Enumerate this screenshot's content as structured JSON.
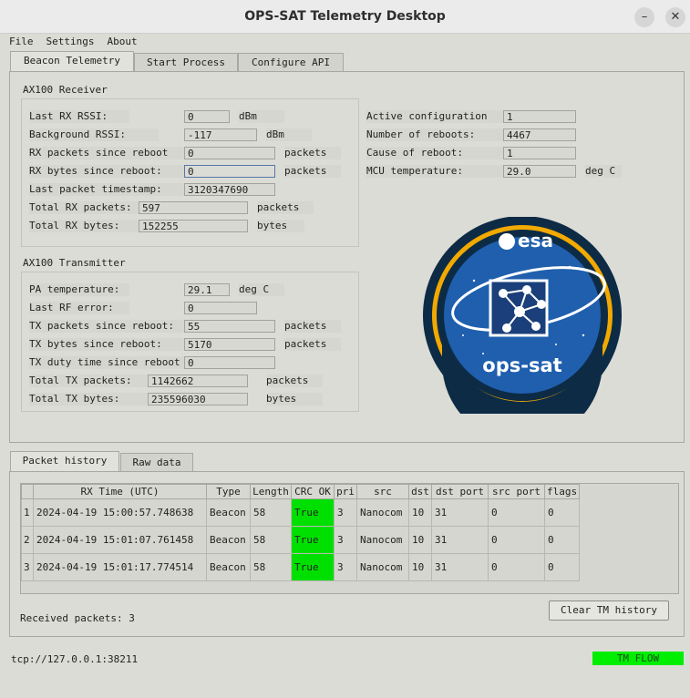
{
  "window": {
    "title": "OPS-SAT Telemetry Desktop",
    "minimize": "–",
    "close": "✕"
  },
  "menu": [
    "File",
    "Settings",
    "About"
  ],
  "tabs": [
    "Beacon Telemetry",
    "Start Process",
    "Configure API"
  ],
  "receiver": {
    "title": "AX100 Receiver",
    "rows": [
      {
        "label": "Last RX RSSI:",
        "value": "0",
        "unit": "dBm"
      },
      {
        "label": "Background RSSI:",
        "value": "-117",
        "unit": "dBm"
      },
      {
        "label": "RX packets since reboot",
        "value": "0",
        "unit": "packets"
      },
      {
        "label": "RX bytes since reboot:",
        "value": "0",
        "unit": "packets"
      },
      {
        "label": "Last packet timestamp:",
        "value": "3120347690",
        "unit": ""
      },
      {
        "label": "Total RX packets:",
        "value": "597",
        "unit": "packets"
      },
      {
        "label": "Total RX bytes:",
        "value": "152255",
        "unit": "bytes"
      }
    ]
  },
  "transmitter": {
    "title": "AX100 Transmitter",
    "rows": [
      {
        "label": "PA temperature:",
        "value": "29.1",
        "unit": "deg C"
      },
      {
        "label": "Last RF error:",
        "value": "0",
        "unit": ""
      },
      {
        "label": "TX packets since reboot:",
        "value": "55",
        "unit": "packets"
      },
      {
        "label": "TX bytes since reboot:",
        "value": "5170",
        "unit": "packets"
      },
      {
        "label": "TX duty time since reboot",
        "value": "0",
        "unit": ""
      },
      {
        "label": "Total TX packets:",
        "value": "1142662",
        "unit": "packets"
      },
      {
        "label": "Total TX bytes:",
        "value": "235596030",
        "unit": "bytes"
      }
    ]
  },
  "system": {
    "rows": [
      {
        "label": "Active configuration",
        "value": "1",
        "unit": ""
      },
      {
        "label": "Number of reboots:",
        "value": "4467",
        "unit": ""
      },
      {
        "label": "Cause of reboot:",
        "value": "1",
        "unit": ""
      },
      {
        "label": "MCU temperature:",
        "value": "29.0",
        "unit": "deg C"
      }
    ]
  },
  "logo": {
    "agency": "esa",
    "mission": "ops-sat",
    "colors": {
      "ring": "#f2a900",
      "dark": "#0d2b45",
      "blue": "#1f5fae"
    }
  },
  "lower_tabs": [
    "Packet history",
    "Raw data"
  ],
  "history": {
    "columns": [
      "RX Time (UTC)",
      "Type",
      "Length",
      "CRC OK",
      "pri",
      "src",
      "dst",
      "dst port",
      "src port",
      "flags"
    ],
    "rows": [
      {
        "num": "1",
        "cells": [
          "2024-04-19 15:00:57.748638",
          "Beacon",
          "58",
          "True",
          "3",
          "Nanocom",
          "10",
          "31",
          "0",
          "0"
        ]
      },
      {
        "num": "2",
        "cells": [
          "2024-04-19 15:01:07.761458",
          "Beacon",
          "58",
          "True",
          "3",
          "Nanocom",
          "10",
          "31",
          "0",
          "0"
        ]
      },
      {
        "num": "3",
        "cells": [
          "2024-04-19 15:01:17.774514",
          "Beacon",
          "58",
          "True",
          "3",
          "Nanocom",
          "10",
          "31",
          "0",
          "0"
        ]
      }
    ],
    "received": "Received packets: 3",
    "clear_label": "Clear TM history"
  },
  "status": {
    "connection": "tcp://127.0.0.1:38211",
    "flow": "TM FLOW",
    "flow_color": "#00ee00"
  }
}
